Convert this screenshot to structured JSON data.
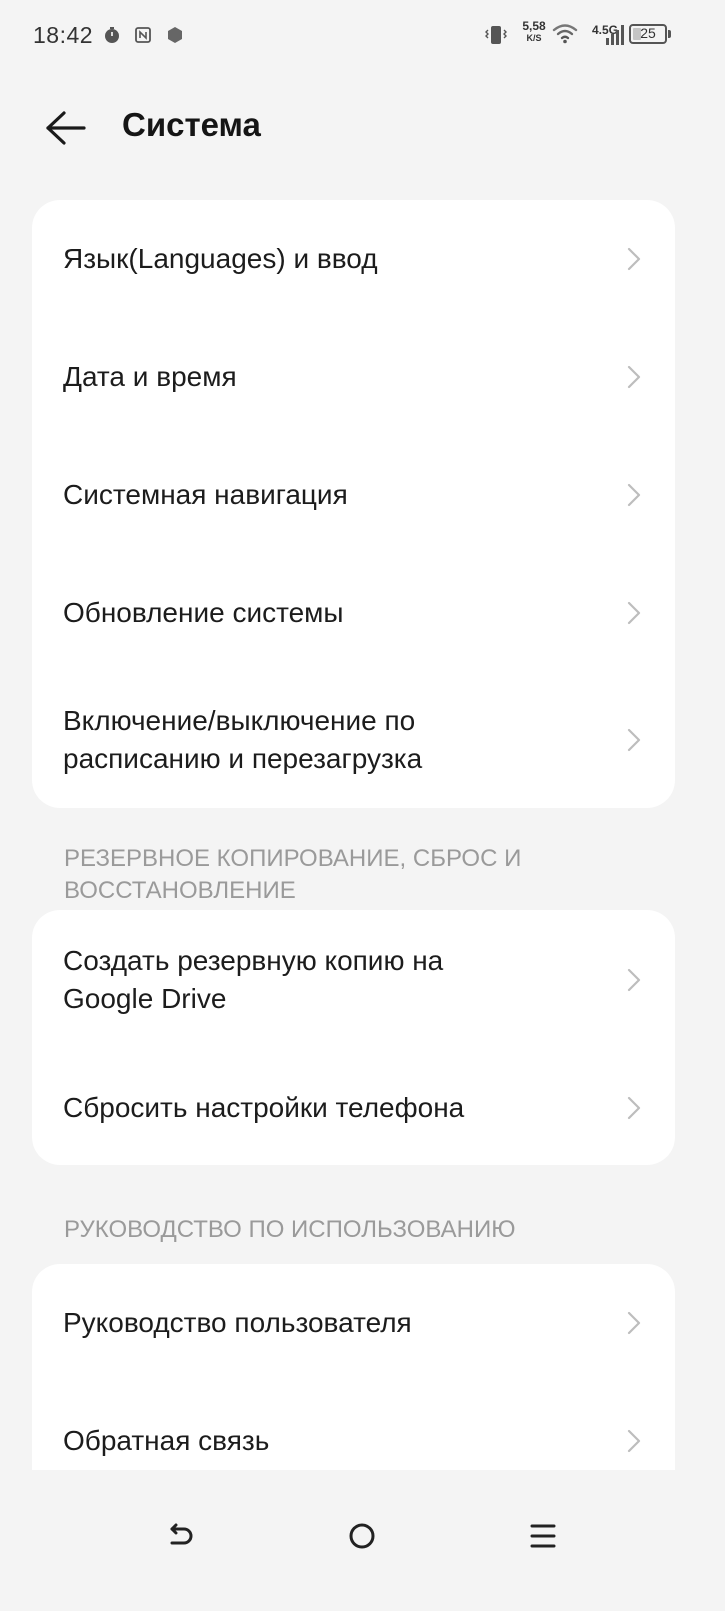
{
  "status_bar": {
    "time": "18:42",
    "net_speed_value": "5,58",
    "net_speed_unit": "K/S",
    "network_type": "4.5G",
    "battery_level": "25",
    "battery_fraction": 0.25
  },
  "header": {
    "title": "Система"
  },
  "groups": [
    {
      "section_title": "",
      "items": [
        {
          "label": "Язык(Languages) и ввод"
        },
        {
          "label": "Дата и время"
        },
        {
          "label": "Системная навигация"
        },
        {
          "label": "Обновление системы"
        },
        {
          "label": "Включение/выключение по\nрасписанию и перезагрузка"
        }
      ]
    },
    {
      "section_title": "РЕЗЕРВНОЕ КОПИРОВАНИЕ, СБРОС И\nВОССТАНОВЛЕНИЕ",
      "items": [
        {
          "label": "Создать резервную копию на\nGoogle Drive"
        },
        {
          "label": "Сбросить настройки телефона"
        }
      ]
    },
    {
      "section_title": "РУКОВОДСТВО ПО ИСПОЛЬЗОВАНИЮ",
      "items": [
        {
          "label": "Руководство пользователя"
        },
        {
          "label": "Обратная связь"
        }
      ]
    }
  ],
  "icons": {
    "back": "arrow-left-icon",
    "chevron": "chevron-right-icon",
    "nav_back": "nav-back-icon",
    "nav_home": "nav-home-icon",
    "nav_recents": "nav-recents-icon"
  },
  "colors": {
    "background": "#f4f4f4",
    "card": "#ffffff",
    "section_header": "#9a9a9a",
    "text": "#1c1c1c",
    "chevron": "#bdbdbd"
  }
}
